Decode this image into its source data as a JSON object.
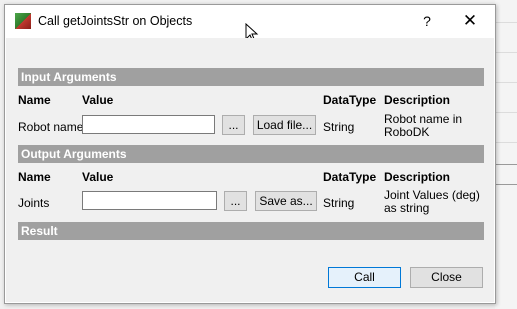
{
  "window": {
    "title": "Call getJointsStr on Objects",
    "help_label": "?",
    "close_label": "✕"
  },
  "input_section": {
    "heading": "Input Arguments",
    "columns": {
      "name": "Name",
      "value": "Value",
      "datatype": "DataType",
      "description": "Description"
    },
    "arg": {
      "name": "Robot name",
      "value": "",
      "browse_label": "...",
      "action_label": "Load file...",
      "datatype": "String",
      "description": "Robot name in RoboDK"
    }
  },
  "output_section": {
    "heading": "Output Arguments",
    "columns": {
      "name": "Name",
      "value": "Value",
      "datatype": "DataType",
      "description": "Description"
    },
    "arg": {
      "name": "Joints",
      "value": "",
      "browse_label": "...",
      "action_label": "Save as...",
      "datatype": "String",
      "description": "Joint Values (deg) as string"
    }
  },
  "result_section": {
    "heading": "Result"
  },
  "footer": {
    "call_label": "Call",
    "close_label": "Close"
  },
  "colors": {
    "section_bar": "#a0a0a0",
    "primary_border": "#0078d7"
  }
}
